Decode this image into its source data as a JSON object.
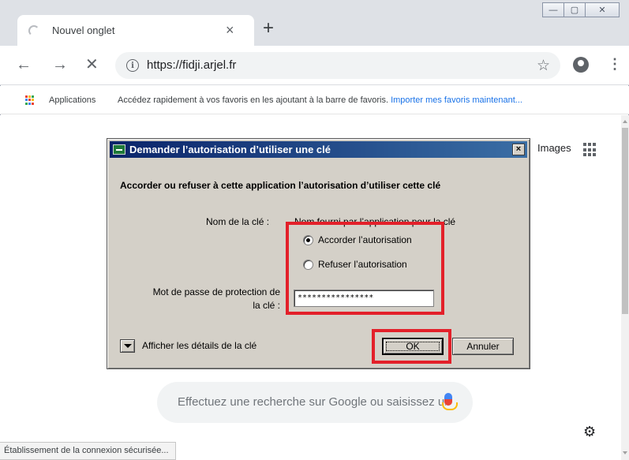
{
  "browser": {
    "tab": {
      "title": "Nouvel onglet",
      "close": "×"
    },
    "new_tab": "+",
    "window_controls": {
      "minimize": "—",
      "maximize": "▢",
      "close": "✕"
    },
    "nav": {
      "back": "←",
      "forward": "→",
      "stop": "✕"
    },
    "address": {
      "url": "https://fidji.arjel.fr",
      "info_icon": "i"
    },
    "star": "☆",
    "menu": "⋮",
    "bookmarks": {
      "apps_label": "Applications",
      "hint": "Accédez rapidement à vos favoris en les ajoutant à la barre de favoris. ",
      "import_link": "Importer mes favoris maintenant...",
      "apps_colors": [
        "#ea4335",
        "#fbbc05",
        "#34a853",
        "#4285f4",
        "#ea4335",
        "#fbbc05",
        "#34a853",
        "#4285f4",
        "#ea4335"
      ]
    },
    "status_text": "Établissement de la connexion sécurisée..."
  },
  "page": {
    "images_link": "Images",
    "search_placeholder": "Effectuez une recherche sur Google ou saisissez une URL",
    "gear": "⚙"
  },
  "dialog": {
    "title": "Demander l’autorisation d’utiliser une clé",
    "close": "×",
    "heading": "Accorder ou refuser à cette application l’autorisation d’utiliser cette clé",
    "key_name_label": "Nom de la clé :",
    "key_name_value": "Nom fourni par l’application pour la clé",
    "radio_grant": "Accorder l’autorisation",
    "radio_refuse": "Refuser l’autorisation",
    "password_label_1": "Mot de passe de protection de",
    "password_label_2": "la clé :",
    "password_value": "****************",
    "details_label": "Afficher les détails de la clé",
    "ok": "OK",
    "cancel": "Annuler"
  },
  "colors": {
    "highlight_red": "#e3202a",
    "dialog_title_start": "#0a246a",
    "dialog_title_end": "#3a6ea5",
    "dialog_face": "#d4d0c8"
  }
}
